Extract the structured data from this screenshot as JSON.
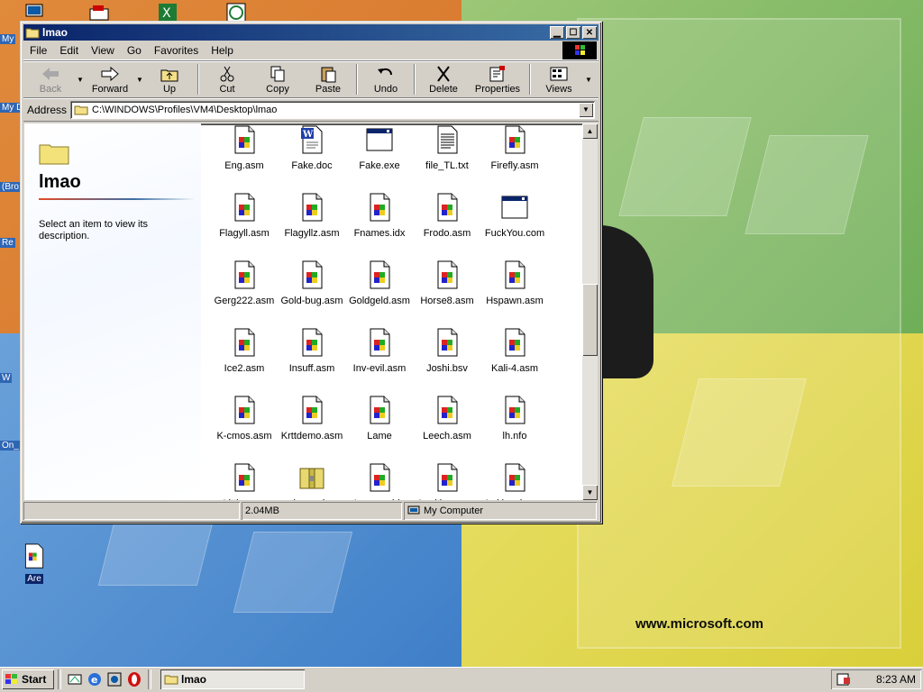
{
  "desktop": {
    "url_text": "www.microsoft.com",
    "edge_labels": [
      "My",
      "My D",
      "(Bro",
      "Re",
      "W",
      "On_"
    ],
    "bottom_icon_label": "Are"
  },
  "window": {
    "title": "lmao",
    "menu": [
      "File",
      "Edit",
      "View",
      "Go",
      "Favorites",
      "Help"
    ],
    "toolbar": {
      "back": "Back",
      "forward": "Forward",
      "up": "Up",
      "cut": "Cut",
      "copy": "Copy",
      "paste": "Paste",
      "undo": "Undo",
      "delete": "Delete",
      "properties": "Properties",
      "views": "Views"
    },
    "address": {
      "label": "Address",
      "path": "C:\\WINDOWS\\Profiles\\VM4\\Desktop\\lmao"
    },
    "left_pane": {
      "title": "lmao",
      "description": "Select an item to view its description."
    },
    "files": [
      {
        "name": "Eng.asm",
        "type": "asm"
      },
      {
        "name": "Fake.doc",
        "type": "doc"
      },
      {
        "name": "Fake.exe",
        "type": "exe"
      },
      {
        "name": "file_TL.txt",
        "type": "txt"
      },
      {
        "name": "Firefly.asm",
        "type": "asm"
      },
      {
        "name": "Flagyll.asm",
        "type": "asm"
      },
      {
        "name": "Flagyllz.asm",
        "type": "asm"
      },
      {
        "name": "Fnames.idx",
        "type": "asm"
      },
      {
        "name": "Frodo.asm",
        "type": "asm"
      },
      {
        "name": "FuckYou.com",
        "type": "exe"
      },
      {
        "name": "Gerg222.asm",
        "type": "asm"
      },
      {
        "name": "Gold-bug.asm",
        "type": "asm"
      },
      {
        "name": "Goldgeld.asm",
        "type": "asm"
      },
      {
        "name": "Horse8.asm",
        "type": "asm"
      },
      {
        "name": "Hspawn.asm",
        "type": "asm"
      },
      {
        "name": "Ice2.asm",
        "type": "asm"
      },
      {
        "name": "Insuff.asm",
        "type": "asm"
      },
      {
        "name": "Inv-evil.asm",
        "type": "asm"
      },
      {
        "name": "Joshi.bsv",
        "type": "asm"
      },
      {
        "name": "Kali-4.asm",
        "type": "asm"
      },
      {
        "name": "K-cmos.asm",
        "type": "asm"
      },
      {
        "name": "Krttdemo.asm",
        "type": "asm"
      },
      {
        "name": "Lame",
        "type": "asm"
      },
      {
        "name": "Leech.asm",
        "type": "asm"
      },
      {
        "name": "lh.nfo",
        "type": "asm"
      },
      {
        "name": "Little.asm",
        "type": "asm"
      },
      {
        "name": "lmao.zip",
        "type": "zip"
      },
      {
        "name": "Lnames.idx",
        "type": "asm"
      },
      {
        "name": "Lockjaw.asm",
        "type": "asm"
      },
      {
        "name": "Lokjawd.asm",
        "type": "asm"
      }
    ],
    "status": {
      "size": "2.04MB",
      "zone": "My Computer"
    }
  },
  "taskbar": {
    "start_label": "Start",
    "task_label": "lmao",
    "clock": "8:23 AM"
  },
  "colors": {
    "title_active": "#0a246a",
    "face": "#d4d0c8"
  }
}
